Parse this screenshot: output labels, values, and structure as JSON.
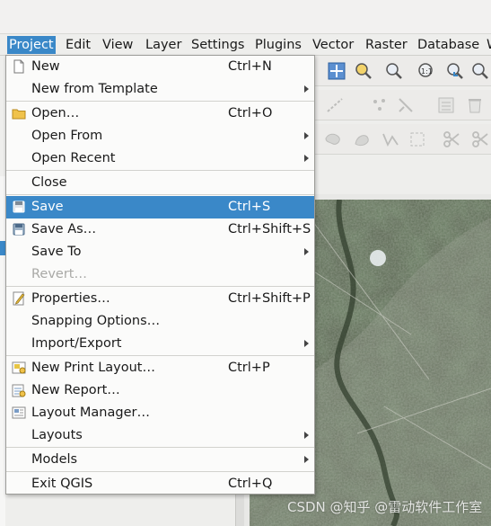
{
  "menubar": {
    "items": [
      "Project",
      "Edit",
      "View",
      "Layer",
      "Settings",
      "Plugins",
      "Vector",
      "Raster",
      "Database",
      "W"
    ]
  },
  "project_menu": {
    "new": {
      "label": "New",
      "shortcut": "Ctrl+N",
      "icon": "new-document-icon"
    },
    "new_from_template": {
      "label": "New from Template"
    },
    "open": {
      "label": "Open…",
      "shortcut": "Ctrl+O",
      "icon": "folder-icon"
    },
    "open_from": {
      "label": "Open From"
    },
    "open_recent": {
      "label": "Open Recent"
    },
    "close": {
      "label": "Close"
    },
    "save": {
      "label": "Save",
      "shortcut": "Ctrl+S",
      "icon": "save-icon"
    },
    "save_as": {
      "label": "Save As…",
      "shortcut": "Ctrl+Shift+S",
      "icon": "save-as-icon"
    },
    "save_to": {
      "label": "Save To"
    },
    "revert": {
      "label": "Revert…"
    },
    "properties": {
      "label": "Properties…",
      "shortcut": "Ctrl+Shift+P",
      "icon": "properties-icon"
    },
    "snapping": {
      "label": "Snapping Options…"
    },
    "import_export": {
      "label": "Import/Export"
    },
    "new_print_layout": {
      "label": "New Print Layout…",
      "shortcut": "Ctrl+P",
      "icon": "print-layout-icon"
    },
    "new_report": {
      "label": "New Report…",
      "icon": "report-icon"
    },
    "layout_manager": {
      "label": "Layout Manager…",
      "icon": "layout-manager-icon"
    },
    "layouts": {
      "label": "Layouts"
    },
    "models": {
      "label": "Models"
    },
    "exit": {
      "label": "Exit QGIS",
      "shortcut": "Ctrl+Q"
    }
  },
  "watermark": "CSDN @知乎 @雷动软件工作室",
  "colors": {
    "highlight": "#3a88c8",
    "menu_bg": "#fbfbfa"
  }
}
